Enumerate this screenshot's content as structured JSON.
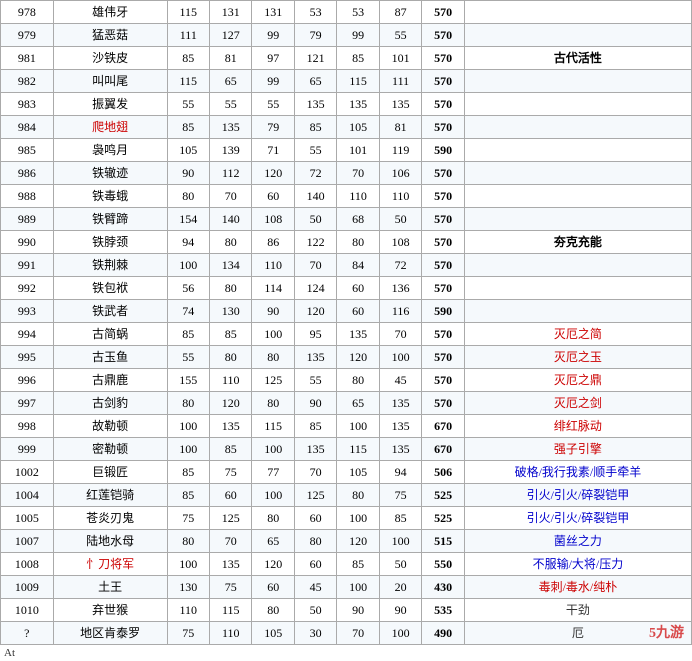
{
  "table": {
    "rows": [
      {
        "id": "978",
        "name": "雄伟牙",
        "name_style": "",
        "stat1": "115",
        "stat2": "131",
        "stat3": "131",
        "stat4": "53",
        "stat5": "53",
        "stat6": "87",
        "total": "570",
        "note": "",
        "note_style": ""
      },
      {
        "id": "979",
        "name": "猛恶菇",
        "name_style": "",
        "stat1": "111",
        "stat2": "127",
        "stat3": "99",
        "stat4": "79",
        "stat5": "99",
        "stat6": "55",
        "total": "570",
        "note": "",
        "note_style": ""
      },
      {
        "id": "981",
        "name": "沙铁皮",
        "name_style": "",
        "stat1": "85",
        "stat2": "81",
        "stat3": "97",
        "stat4": "121",
        "stat5": "85",
        "stat6": "101",
        "total": "570",
        "note": "古代活性",
        "note_style": "right-note"
      },
      {
        "id": "982",
        "name": "叫叫尾",
        "name_style": "",
        "stat1": "115",
        "stat2": "65",
        "stat3": "99",
        "stat4": "65",
        "stat5": "115",
        "stat6": "111",
        "total": "570",
        "note": "",
        "note_style": ""
      },
      {
        "id": "983",
        "name": "振翼发",
        "name_style": "",
        "stat1": "55",
        "stat2": "55",
        "stat3": "55",
        "stat4": "135",
        "stat5": "135",
        "stat6": "135",
        "total": "570",
        "note": "",
        "note_style": ""
      },
      {
        "id": "984",
        "name": "爬地翅",
        "name_style": "name-red",
        "stat1": "85",
        "stat2": "135",
        "stat3": "79",
        "stat4": "85",
        "stat5": "105",
        "stat6": "81",
        "total": "570",
        "note": "",
        "note_style": ""
      },
      {
        "id": "985",
        "name": "袅鸣月",
        "name_style": "",
        "stat1": "105",
        "stat2": "139",
        "stat3": "71",
        "stat4": "55",
        "stat5": "101",
        "stat6": "119",
        "total": "590",
        "note": "",
        "note_style": ""
      },
      {
        "id": "986",
        "name": "铁辙迹",
        "name_style": "",
        "stat1": "90",
        "stat2": "112",
        "stat3": "120",
        "stat4": "72",
        "stat5": "70",
        "stat6": "106",
        "total": "570",
        "note": "",
        "note_style": ""
      },
      {
        "id": "988",
        "name": "铁毒蛾",
        "name_style": "",
        "stat1": "80",
        "stat2": "70",
        "stat3": "60",
        "stat4": "140",
        "stat5": "110",
        "stat6": "110",
        "total": "570",
        "note": "",
        "note_style": ""
      },
      {
        "id": "989",
        "name": "铁臂蹄",
        "name_style": "",
        "stat1": "154",
        "stat2": "140",
        "stat3": "108",
        "stat4": "50",
        "stat5": "68",
        "stat6": "50",
        "total": "570",
        "note": "",
        "note_style": ""
      },
      {
        "id": "990",
        "name": "铁脖颈",
        "name_style": "",
        "stat1": "94",
        "stat2": "80",
        "stat3": "86",
        "stat4": "122",
        "stat5": "80",
        "stat6": "108",
        "total": "570",
        "note": "夯克充能",
        "note_style": "right-note"
      },
      {
        "id": "991",
        "name": "铁荆棘",
        "name_style": "",
        "stat1": "100",
        "stat2": "134",
        "stat3": "110",
        "stat4": "70",
        "stat5": "84",
        "stat6": "72",
        "total": "570",
        "note": "",
        "note_style": ""
      },
      {
        "id": "992",
        "name": "铁包袱",
        "name_style": "",
        "stat1": "56",
        "stat2": "80",
        "stat3": "114",
        "stat4": "124",
        "stat5": "60",
        "stat6": "136",
        "total": "570",
        "note": "",
        "note_style": ""
      },
      {
        "id": "993",
        "name": "铁武者",
        "name_style": "",
        "stat1": "74",
        "stat2": "130",
        "stat3": "90",
        "stat4": "120",
        "stat5": "60",
        "stat6": "116",
        "total": "590",
        "note": "",
        "note_style": ""
      },
      {
        "id": "994",
        "name": "古简蜗",
        "name_style": "",
        "stat1": "85",
        "stat2": "85",
        "stat3": "100",
        "stat4": "95",
        "stat5": "135",
        "stat6": "70",
        "total": "570",
        "note": "灭厄之简",
        "note_style": "note-red"
      },
      {
        "id": "995",
        "name": "古玉鱼",
        "name_style": "",
        "stat1": "55",
        "stat2": "80",
        "stat3": "80",
        "stat4": "135",
        "stat5": "120",
        "stat6": "100",
        "total": "570",
        "note": "灭厄之玉",
        "note_style": "note-red"
      },
      {
        "id": "996",
        "name": "古鼎鹿",
        "name_style": "",
        "stat1": "155",
        "stat2": "110",
        "stat3": "125",
        "stat4": "55",
        "stat5": "80",
        "stat6": "45",
        "total": "570",
        "note": "灭厄之鼎",
        "note_style": "note-red"
      },
      {
        "id": "997",
        "name": "古剑豹",
        "name_style": "",
        "stat1": "80",
        "stat2": "120",
        "stat3": "80",
        "stat4": "90",
        "stat5": "65",
        "stat6": "135",
        "total": "570",
        "note": "灭厄之剑",
        "note_style": "note-red"
      },
      {
        "id": "998",
        "name": "故勒顿",
        "name_style": "",
        "stat1": "100",
        "stat2": "135",
        "stat3": "115",
        "stat4": "85",
        "stat5": "100",
        "stat6": "135",
        "total": "670",
        "note": "绯红脉动",
        "note_style": "note-red"
      },
      {
        "id": "999",
        "name": "密勒顿",
        "name_style": "",
        "stat1": "100",
        "stat2": "85",
        "stat3": "100",
        "stat4": "135",
        "stat5": "115",
        "stat6": "135",
        "total": "670",
        "note": "强子引擎",
        "note_style": "note-red"
      },
      {
        "id": "1002",
        "name": "巨锻匠",
        "name_style": "",
        "stat1": "85",
        "stat2": "75",
        "stat3": "77",
        "stat4": "70",
        "stat5": "105",
        "stat6": "94",
        "total": "506",
        "note": "破格/我行我素/顺手牵羊",
        "note_style": "note-blue"
      },
      {
        "id": "1004",
        "name": "红莲铠骑",
        "name_style": "",
        "stat1": "85",
        "stat2": "60",
        "stat3": "100",
        "stat4": "125",
        "stat5": "80",
        "stat6": "75",
        "total": "525",
        "note": "引火/引火/碎裂铠甲",
        "note_style": "note-blue"
      },
      {
        "id": "1005",
        "name": "苍炎刃鬼",
        "name_style": "",
        "stat1": "75",
        "stat2": "125",
        "stat3": "80",
        "stat4": "60",
        "stat5": "100",
        "stat6": "85",
        "total": "525",
        "note": "引火/引火/碎裂铠甲",
        "note_style": "note-blue"
      },
      {
        "id": "1007",
        "name": "陆地水母",
        "name_style": "",
        "stat1": "80",
        "stat2": "70",
        "stat3": "65",
        "stat4": "80",
        "stat5": "120",
        "stat6": "100",
        "total": "515",
        "note": "菌丝之力",
        "note_style": "note-blue"
      },
      {
        "id": "1008",
        "name": "忄刀将军",
        "name_style": "name-red",
        "stat1": "100",
        "stat2": "135",
        "stat3": "120",
        "stat4": "60",
        "stat5": "85",
        "stat6": "50",
        "total": "550",
        "note": "不服输/大将/压力",
        "note_style": "note-blue"
      },
      {
        "id": "1009",
        "name": "土王",
        "name_style": "",
        "stat1": "130",
        "stat2": "75",
        "stat3": "60",
        "stat4": "45",
        "stat5": "100",
        "stat6": "20",
        "total": "430",
        "note": "毒刺/毒水/纯朴",
        "note_style": "note-red"
      },
      {
        "id": "1010",
        "name": "弃世猴",
        "name_style": "",
        "stat1": "110",
        "stat2": "115",
        "stat3": "80",
        "stat4": "50",
        "stat5": "90",
        "stat6": "90",
        "total": "535",
        "note": "干劲",
        "note_style": "note-partial"
      },
      {
        "id": "?",
        "name": "地区肯泰罗",
        "name_style": "",
        "stat1": "75",
        "stat2": "110",
        "stat3": "105",
        "stat4": "30",
        "stat5": "70",
        "stat6": "100",
        "total": "490",
        "note": "厄",
        "note_style": "note-partial"
      }
    ],
    "footer": "At"
  },
  "watermark": "5九游",
  "colors": {
    "header_bg": "#c8e0f0",
    "row_even": "#f0f7fc",
    "row_odd": "#ffffff",
    "red": "#cc0000",
    "blue": "#0000cc",
    "border": "#aaaaaa"
  }
}
